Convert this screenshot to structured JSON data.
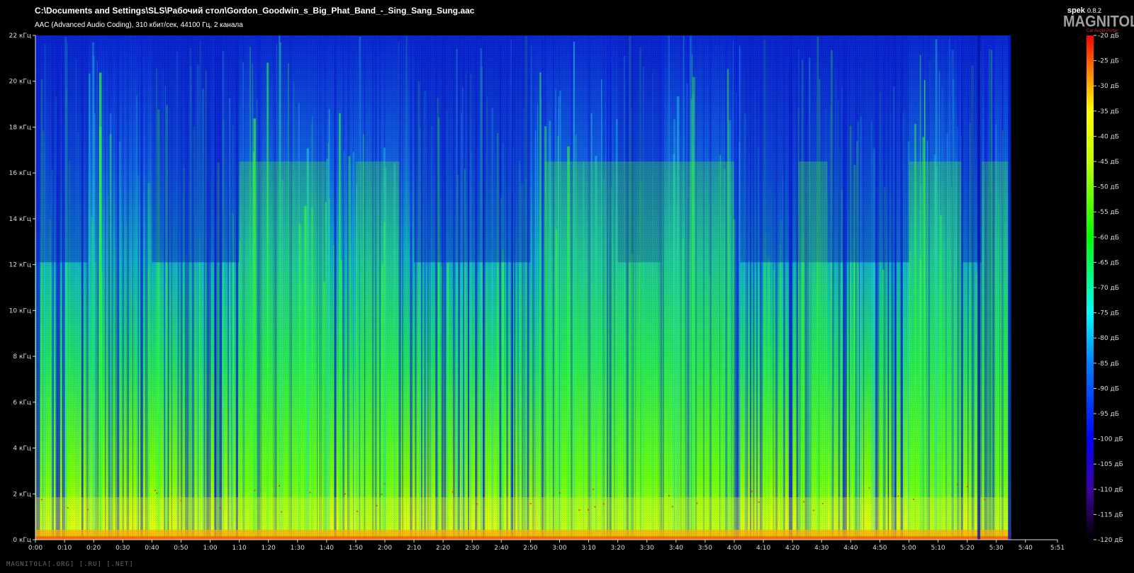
{
  "header": {
    "file_path": "C:\\Documents and Settings\\SLS\\Рабочий стол\\Gordon_Goodwin_s_Big_Phat_Band_-_Sing_Sang_Sung.aac",
    "stream_info": "AAC (Advanced Audio Coding), 310 кбит/сек, 44100 Гц, 2 канала",
    "app_name": "spek",
    "app_version": "0.8.2"
  },
  "logo": {
    "text": "MAGNITOLA",
    "subtext": "Car Audio Portal"
  },
  "watermark": "MAGNITOLA[.ORG] [.RU] [.NET]",
  "colors": {
    "background": "#000000",
    "text": "#dddddd",
    "scale_low": "#000000",
    "scale_mid_low": "#0000ff",
    "scale_mid": "#00ffff",
    "scale_mid_high": "#00ff00",
    "scale_high": "#ffff00",
    "scale_peak": "#ff0000"
  },
  "chart_data": {
    "type": "heatmap",
    "title": "C:\\Documents and Settings\\SLS\\Рабочий стол\\Gordon_Goodwin_s_Big_Phat_Band_-_Sing_Sang_Sung.aac",
    "subtitle": "AAC (Advanced Audio Coding), 310 кбит/сек, 44100 Гц, 2 канала",
    "xlabel": "",
    "ylabel": "",
    "xlim": [
      "0:00",
      "5:51"
    ],
    "ylim_khz": [
      0,
      22
    ],
    "x_ticks": [
      "0:00",
      "0:10",
      "0:20",
      "0:30",
      "0:40",
      "0:50",
      "1:00",
      "1:10",
      "1:20",
      "1:30",
      "1:40",
      "1:50",
      "2:00",
      "2:10",
      "2:20",
      "2:30",
      "2:40",
      "2:50",
      "3:00",
      "3:10",
      "3:20",
      "3:30",
      "3:40",
      "3:50",
      "4:00",
      "4:10",
      "4:20",
      "4:30",
      "4:40",
      "4:50",
      "5:00",
      "5:10",
      "5:20",
      "5:30",
      "5:40",
      "5:51"
    ],
    "y_ticks": [
      "0 кГц",
      "2 кГц",
      "4 кГц",
      "6 кГц",
      "8 кГц",
      "10 кГц",
      "12 кГц",
      "14 кГц",
      "16 кГц",
      "18 кГц",
      "20 кГц",
      "22 кГц"
    ],
    "colorbar_ticks": [
      "-20 дБ",
      "-25 дБ",
      "-30 дБ",
      "-35 дБ",
      "-40 дБ",
      "-45 дБ",
      "-50 дБ",
      "-55 дБ",
      "-60 дБ",
      "-65 дБ",
      "-70 дБ",
      "-75 дБ",
      "-80 дБ",
      "-85 дБ",
      "-90 дБ",
      "-95 дБ",
      "-100 дБ",
      "-105 дБ",
      "-110 дБ",
      "-115 дБ",
      "-120 дБ"
    ],
    "colorbar_range_db": [
      -120,
      -20
    ],
    "audio_end_seconds": 335
  }
}
